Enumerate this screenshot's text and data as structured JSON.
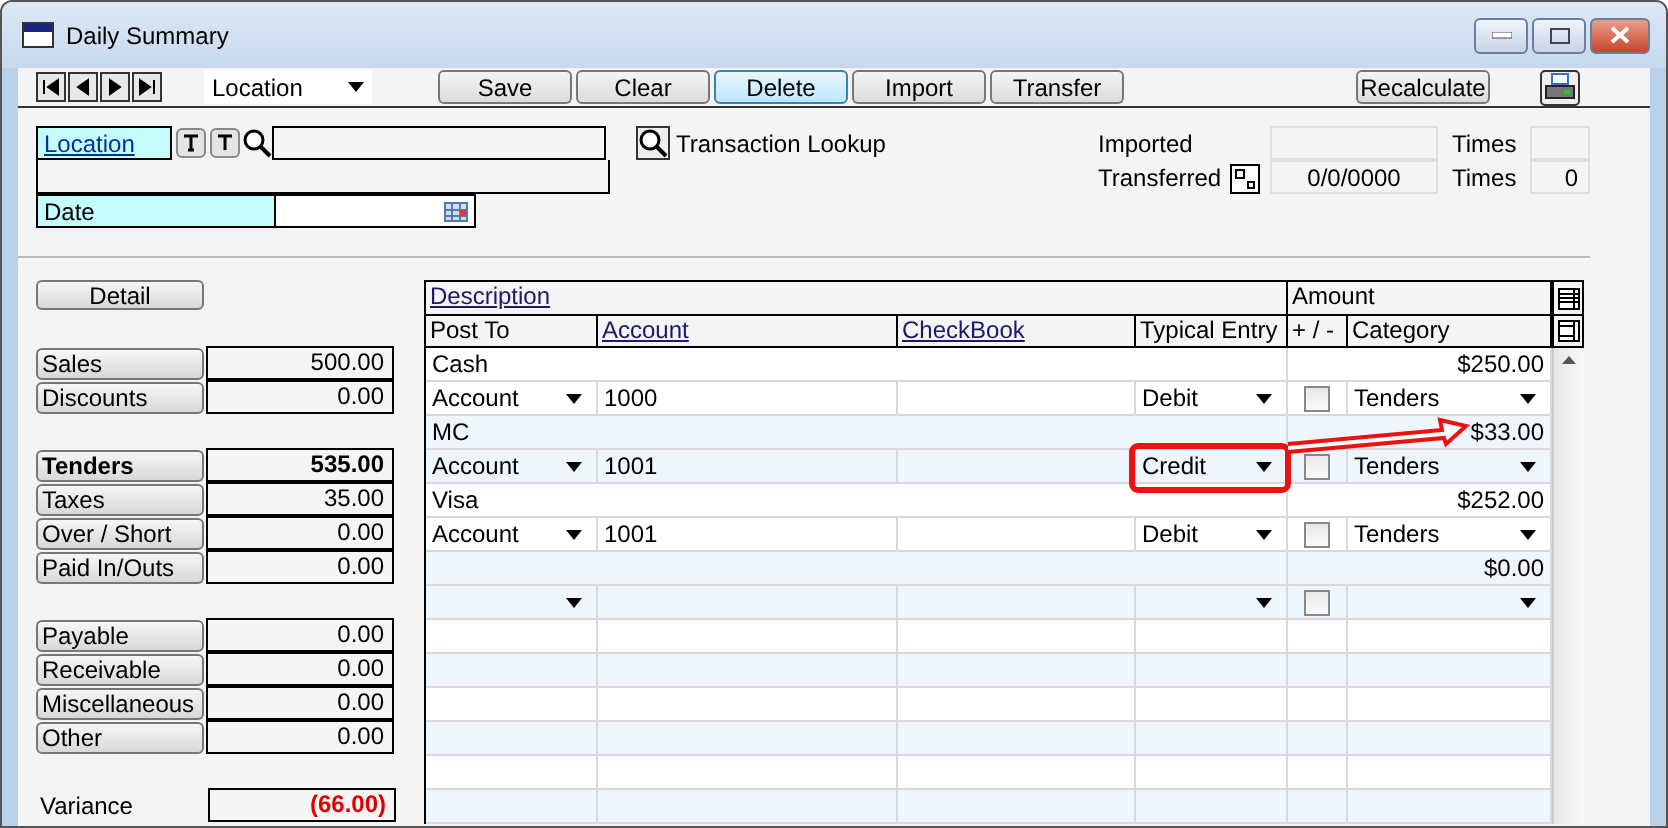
{
  "window": {
    "title": "Daily Summary"
  },
  "toolbar": {
    "view_select": "Location",
    "buttons": [
      {
        "label": "Save",
        "selected": false
      },
      {
        "label": "Clear",
        "selected": false
      },
      {
        "label": "Delete",
        "selected": true
      },
      {
        "label": "Import",
        "selected": false
      },
      {
        "label": "Transfer",
        "selected": false
      }
    ],
    "recalculate": "Recalculate"
  },
  "form": {
    "location_label": "Location",
    "date_label": "Date",
    "lookup": "Transaction Lookup",
    "imported_label": "Imported",
    "transferred_label": "Transferred",
    "transferred_date": "0/0/0000",
    "times_labels": [
      "Times",
      "Times"
    ],
    "transferred_times": "0"
  },
  "detail_button": "Detail",
  "summary_groups": [
    [
      {
        "label": "Sales",
        "value": "500.00",
        "bold": false
      },
      {
        "label": "Discounts",
        "value": "0.00",
        "bold": false
      }
    ],
    [
      {
        "label": "Tenders",
        "value": "535.00",
        "bold": true
      },
      {
        "label": "Taxes",
        "value": "35.00",
        "bold": false
      },
      {
        "label": "Over / Short",
        "value": "0.00",
        "bold": false
      },
      {
        "label": "Paid In/Outs",
        "value": "0.00",
        "bold": false
      }
    ],
    [
      {
        "label": "Payable",
        "value": "0.00",
        "bold": false
      },
      {
        "label": "Receivable",
        "value": "0.00",
        "bold": false
      },
      {
        "label": "Miscellaneous",
        "value": "0.00",
        "bold": false
      },
      {
        "label": "Other",
        "value": "0.00",
        "bold": false
      }
    ]
  ],
  "variance": {
    "label": "Variance",
    "value": "(66.00)",
    "negative": true
  },
  "table": {
    "header_top": [
      "Description",
      "Amount"
    ],
    "columns": [
      "Post To",
      "Account",
      "CheckBook",
      "Typical Entry",
      "+ / -",
      "Category"
    ],
    "rows": [
      {
        "description": "Cash",
        "amount": "$250.00",
        "post_to": "Account",
        "account": "1000",
        "typical_entry": "Debit",
        "checked": false,
        "category": "Tenders",
        "callout": false
      },
      {
        "description": "MC",
        "amount": "$33.00",
        "post_to": "Account",
        "account": "1001",
        "typical_entry": "Credit",
        "checked": false,
        "category": "Tenders",
        "callout": true
      },
      {
        "description": "Visa",
        "amount": "$252.00",
        "post_to": "Account",
        "account": "1001",
        "typical_entry": "Debit",
        "checked": false,
        "category": "Tenders",
        "callout": false
      },
      {
        "amount": "$0.00",
        "checked": false,
        "callout": false
      }
    ]
  }
}
